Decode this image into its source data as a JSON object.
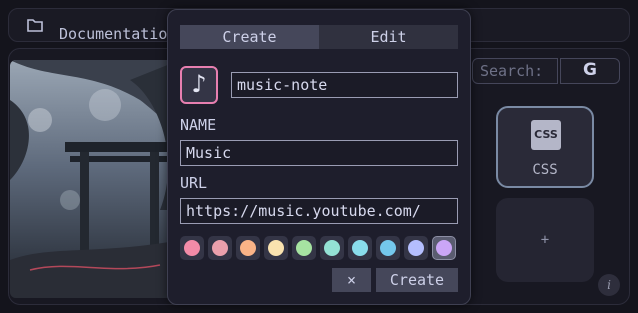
{
  "breadcrumb": {
    "text": "Documentation",
    "icon": "folder-icon"
  },
  "search": {
    "placeholder": "Search:",
    "engine_label": "G"
  },
  "tiles": [
    {
      "label": "CSS",
      "logo_text": "CSS",
      "icon": "css-icon"
    },
    {
      "label": "+"
    }
  ],
  "info_label": "i",
  "modal": {
    "tabs": [
      {
        "label": "Create",
        "active": true
      },
      {
        "label": "Edit",
        "active": false
      }
    ],
    "icon_glyph": "♪",
    "icon_name_value": "music-note",
    "name_label": "NAME",
    "name_value": "Music",
    "url_label": "URL",
    "url_value": "https://music.youtube.com/",
    "swatches": [
      "#f38ba8",
      "#eba0ac",
      "#fab387",
      "#f9e2af",
      "#a6e3a1",
      "#94e2d5",
      "#89dceb",
      "#74c7ec",
      "#b4befe",
      "#cba6f7"
    ],
    "selected_swatch": 9,
    "close_label": "×",
    "create_label": "Create"
  },
  "colors": {
    "accent_pink": "#e77fb0",
    "tab_active": "#45475a",
    "background": "#14141c"
  }
}
